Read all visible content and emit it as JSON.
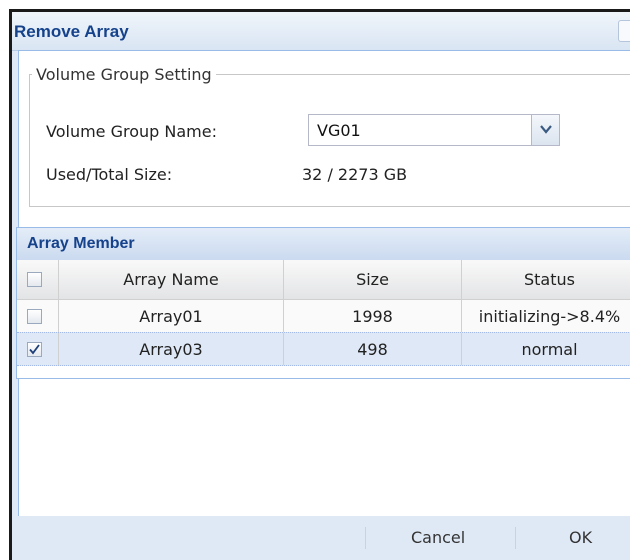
{
  "dialog": {
    "title": "Remove Array"
  },
  "volume_group_setting": {
    "legend": "Volume Group Setting",
    "name_label": "Volume Group Name:",
    "name_value": "VG01",
    "size_label": "Used/Total Size:",
    "size_value": "32 / 2273 GB"
  },
  "array_member": {
    "title": "Array Member",
    "columns": [
      "Array Name",
      "Size",
      "Status"
    ],
    "rows": [
      {
        "checked": false,
        "name": "Array01",
        "size": "1998",
        "status": "initializing->8.4%"
      },
      {
        "checked": true,
        "name": "Array03",
        "size": "498",
        "status": "normal"
      }
    ]
  },
  "footer": {
    "cancel_label": "Cancel",
    "ok_label": "OK"
  },
  "icons": {
    "dropdown": "chevron-down-icon",
    "check": "checkmark-icon"
  },
  "colors": {
    "title": "#15428b",
    "dialog_bg": "#dfe9f6",
    "border": "#99bbe8"
  }
}
